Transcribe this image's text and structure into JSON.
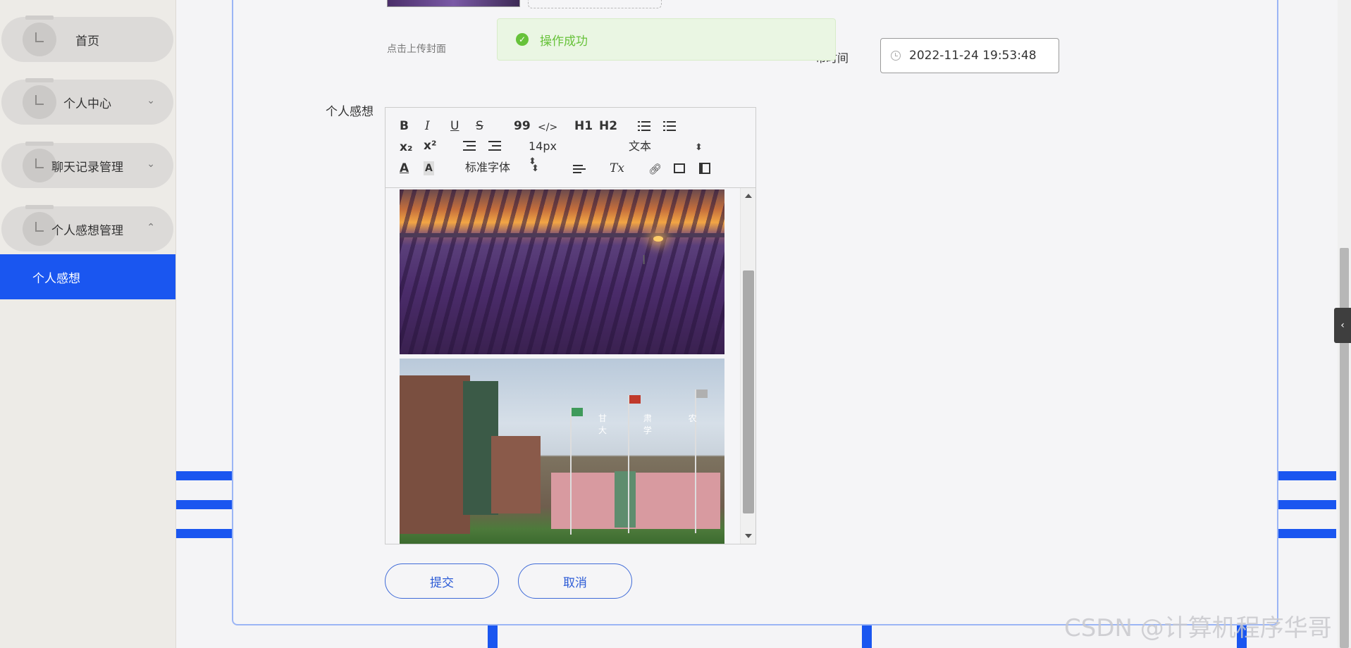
{
  "sidebar": {
    "items": [
      {
        "label": "首页",
        "chevron": ""
      },
      {
        "label": "个人中心",
        "chevron": "⌄"
      },
      {
        "label": "聊天记录管理",
        "chevron": "⌄"
      },
      {
        "label": "个人感想管理",
        "chevron": "⌃"
      }
    ],
    "active_sub": "个人感想"
  },
  "form": {
    "cover_hint": "点击上传封面",
    "publish_label": "布时间",
    "publish_value": "2022-11-24 19:53:48",
    "content_label": "个人感想"
  },
  "toast": {
    "message": "操作成功",
    "icon": "check-icon"
  },
  "editor": {
    "toolbar": {
      "bold": "B",
      "italic": "I",
      "underline": "U",
      "strike": "S",
      "quote": "99",
      "code": "</>",
      "h1": "H1",
      "h2": "H2",
      "sub": "x₂",
      "sup": "x²",
      "font_size": "14px",
      "header": "文本",
      "font_family": "标准字体",
      "color": "A",
      "bg": "A",
      "clear": "Tx"
    },
    "image_text": "甘 肃 农 大 学",
    "images": [
      "lavender-field",
      "campus-building"
    ]
  },
  "buttons": {
    "submit": "提交",
    "cancel": "取消"
  },
  "watermark": "CSDN @计算机程序华哥",
  "colors": {
    "accent": "#1a56f0",
    "success": "#67c23a",
    "button_text": "#2c5bd6"
  }
}
